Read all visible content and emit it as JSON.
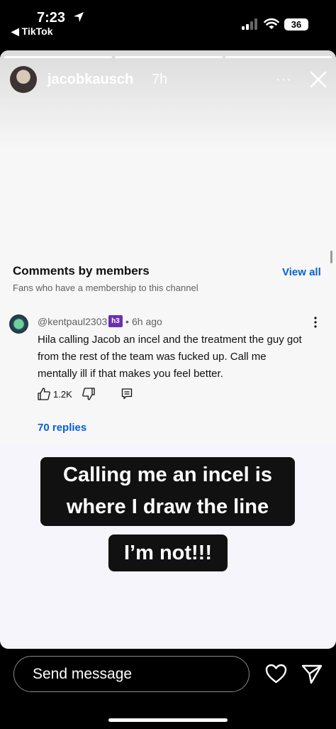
{
  "status_bar": {
    "time": "7:23",
    "back_app": "◀ TikTok",
    "battery": "36"
  },
  "story": {
    "username": "jacobkausch",
    "time_ago": "7h",
    "more_label": "···",
    "progress_segments": 3
  },
  "comments": {
    "title": "Comments by members",
    "subtitle": "Fans who have a membership to this channel",
    "view_all": "View all",
    "comment": {
      "user": "@kentpaul2303",
      "badge": "h3",
      "dot": "•",
      "time": "6h ago",
      "text": "Hila calling Jacob an incel and the treatment the guy got from the rest of the team was fucked up. Call me mentally ill if that makes you feel better.",
      "likes": "1.2K",
      "replies": "70 replies"
    }
  },
  "captions": {
    "line1": "Calling me an incel is",
    "line2": "where I draw the line",
    "line3": "I’m not!!!"
  },
  "bottom_bar": {
    "send_placeholder": "Send message"
  },
  "colors": {
    "link_blue": "#065fd4",
    "caption_bg": "#111111",
    "badge_purple": "#6b2fb3"
  }
}
